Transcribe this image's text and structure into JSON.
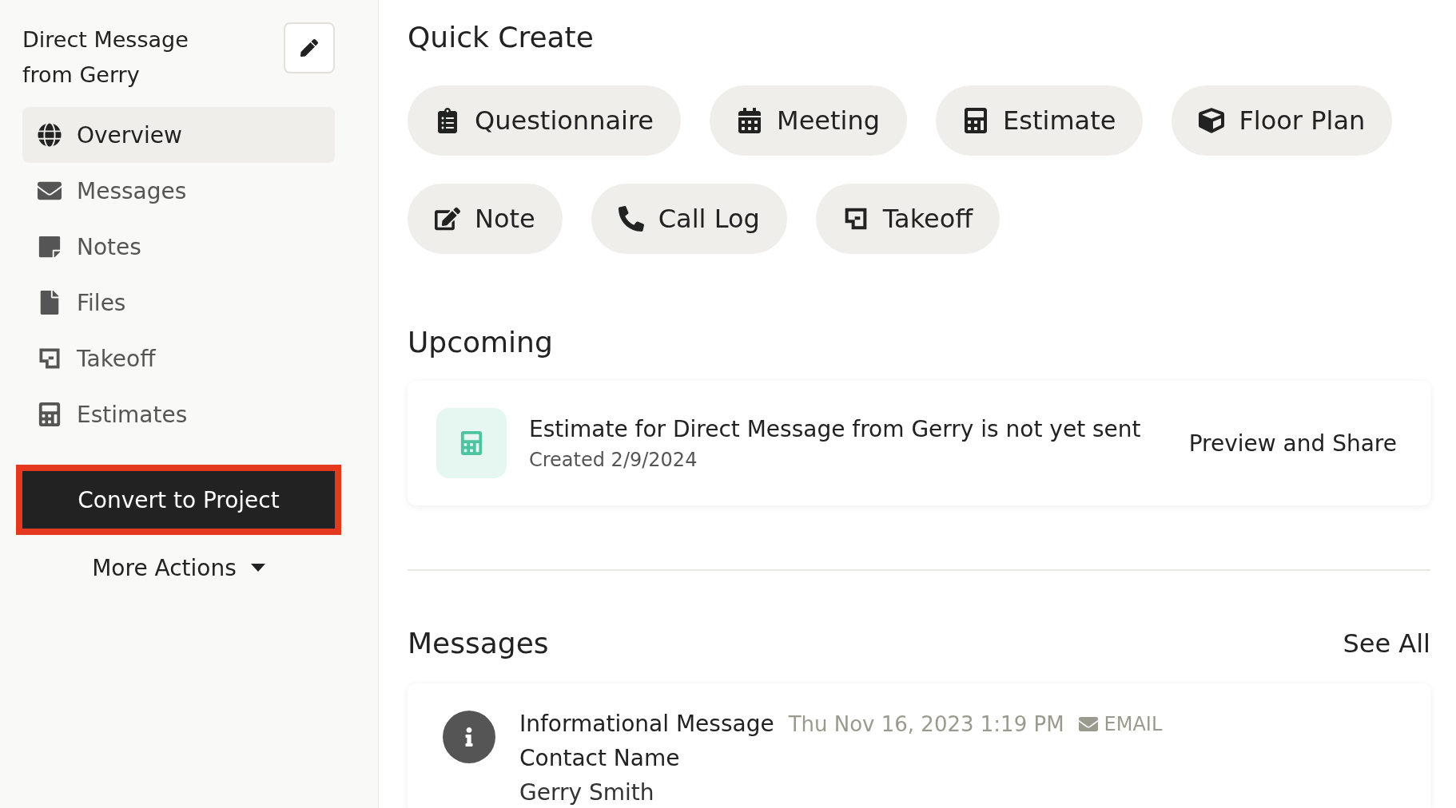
{
  "sidebar": {
    "title": "Direct Message from Gerry",
    "nav": [
      {
        "label": "Overview",
        "selected": true
      },
      {
        "label": "Messages",
        "selected": false
      },
      {
        "label": "Notes",
        "selected": false
      },
      {
        "label": "Files",
        "selected": false
      },
      {
        "label": "Takeoff",
        "selected": false
      },
      {
        "label": "Estimates",
        "selected": false
      }
    ],
    "primary_button": "Convert to Project",
    "more_actions": "More Actions"
  },
  "quick_create": {
    "title": "Quick Create",
    "items": [
      "Questionnaire",
      "Meeting",
      "Estimate",
      "Floor Plan",
      "Note",
      "Call Log",
      "Takeoff"
    ]
  },
  "upcoming": {
    "title": "Upcoming",
    "items": [
      {
        "title": "Estimate for Direct Message from Gerry is not yet sent",
        "subtitle": "Created 2/9/2024",
        "action": "Preview and Share"
      }
    ]
  },
  "messages": {
    "title": "Messages",
    "see_all": "See All",
    "items": [
      {
        "title": "Informational Message",
        "date": "Thu Nov 16, 2023 1:19 PM",
        "channel": "EMAIL",
        "field_label": "Contact Name",
        "field_value": "Gerry Smith"
      }
    ]
  }
}
